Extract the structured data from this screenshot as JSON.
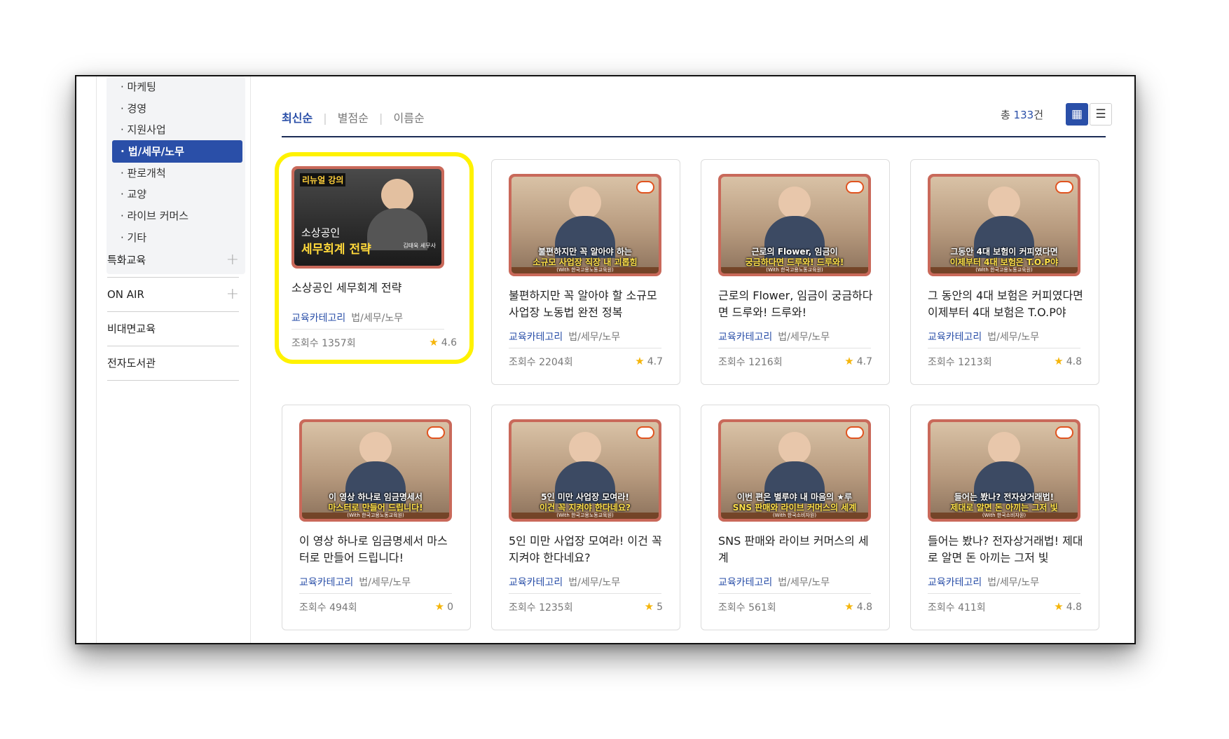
{
  "sidebar": {
    "sub_items": [
      {
        "label": "· 마케팅",
        "active": false
      },
      {
        "label": "· 경영",
        "active": false
      },
      {
        "label": "· 지원사업",
        "active": false
      },
      {
        "label": "· 법/세무/노무",
        "active": true
      },
      {
        "label": "· 판로개척",
        "active": false
      },
      {
        "label": "· 교양",
        "active": false
      },
      {
        "label": "· 라이브 커머스",
        "active": false
      },
      {
        "label": "· 기타",
        "active": false
      }
    ],
    "menu": [
      {
        "label": "특화교육",
        "expand": "+"
      },
      {
        "label": "ON AIR",
        "expand": "+"
      },
      {
        "label": "비대면교육",
        "expand": ""
      },
      {
        "label": "전자도서관",
        "expand": ""
      }
    ]
  },
  "sort": {
    "tabs": [
      "최신순",
      "별점순",
      "이름순"
    ],
    "active_index": 0
  },
  "total": {
    "prefix": "총 ",
    "count": "133",
    "suffix": "건"
  },
  "view": {
    "grid_icon": "grid-view-icon",
    "list_icon": "list-view-icon",
    "active": "grid"
  },
  "cards": [
    {
      "title": "소상공인 세무회계 전략",
      "category_label": "교육카테고리",
      "category": "법/세무/노무",
      "views": "조회수 1357회",
      "rating": "4.6",
      "highlighted": true,
      "thumb": {
        "style": "dark",
        "line1": "리뉴얼 강의",
        "line2": "소상공인",
        "line3": "세무회계 전략",
        "sub": "김태욱 세무사"
      }
    },
    {
      "title": "불편하지만 꼭 알아야 할 소규모 사업장 노동법 완전 정복",
      "category_label": "교육카테고리",
      "category": "법/세무/노무",
      "views": "조회수 2204회",
      "rating": "4.7",
      "highlighted": false,
      "thumb": {
        "style": "light",
        "line1": "불편하지만 꼭 알아야 하는",
        "line2": "소규모 사업장 직장 내 괴롭힘",
        "sub": "(With 한국고용노동교육원)"
      }
    },
    {
      "title": "근로의 Flower, 임금이 궁금하다면 드루와! 드루와!",
      "category_label": "교육카테고리",
      "category": "법/세무/노무",
      "views": "조회수 1216회",
      "rating": "4.7",
      "highlighted": false,
      "thumb": {
        "style": "light",
        "line1": "근로의 Flower, 임금이",
        "line2": "궁금하다면 드루와! 드루와!",
        "sub": "(With 한국고용노동교육원)"
      }
    },
    {
      "title": "그 동안의 4대 보험은 커피였다면 이제부터 4대 보험은 T.O.P야",
      "category_label": "교육카테고리",
      "category": "법/세무/노무",
      "views": "조회수 1213회",
      "rating": "4.8",
      "highlighted": false,
      "thumb": {
        "style": "light",
        "line1": "그동안 4대 보험이 커피였다면",
        "line2": "이제부터 4대 보험은 T.O.P야",
        "sub": "(With 한국고용노동교육원)"
      }
    },
    {
      "title": "이 영상 하나로 임금명세서 마스터로 만들어 드립니다!",
      "category_label": "교육카테고리",
      "category": "법/세무/노무",
      "views": "조회수 494회",
      "rating": "0",
      "highlighted": false,
      "thumb": {
        "style": "light",
        "line1": "이 영상 하나로 임금명세서",
        "line2": "마스터로 만들어 드립니다!",
        "sub": "(With 한국고용노동교육원)"
      }
    },
    {
      "title": "5인 미만 사업장 모여라! 이건 꼭 지켜야 한다네요?",
      "category_label": "교육카테고리",
      "category": "법/세무/노무",
      "views": "조회수 1235회",
      "rating": "5",
      "highlighted": false,
      "thumb": {
        "style": "light",
        "line1": "5인 미만 사업장 모여라!",
        "line2": "이건 꼭 지켜야 한다네요?",
        "sub": "(With 한국고용노동교육원)"
      }
    },
    {
      "title": "SNS 판매와 라이브 커머스의 세계",
      "category_label": "교육카테고리",
      "category": "법/세무/노무",
      "views": "조회수 561회",
      "rating": "4.8",
      "highlighted": false,
      "thumb": {
        "style": "light",
        "line1": "이번 편은 별루야 내 마음의 ★루",
        "line2": "SNS 판매와 라이브 커머스의 세계",
        "sub": "(With 한국소비자원)"
      }
    },
    {
      "title": "들어는 봤나? 전자상거래법! 제대로 알면 돈 아끼는 그저 빛",
      "category_label": "교육카테고리",
      "category": "법/세무/노무",
      "views": "조회수 411회",
      "rating": "4.8",
      "highlighted": false,
      "thumb": {
        "style": "light",
        "line1": "들어는 봤나? 전자상거래법!",
        "line2": "제대로 알면 돈 아끼는 그저 빛",
        "sub": "(With 한국소비자원)"
      }
    }
  ]
}
